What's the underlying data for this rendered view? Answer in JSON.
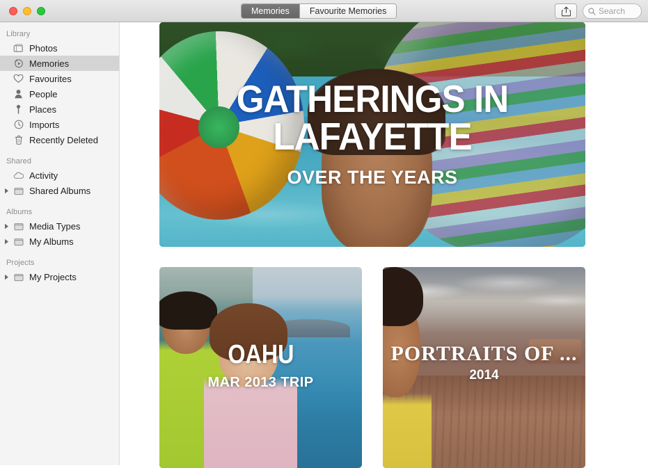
{
  "window": {
    "traffic_lights": [
      "close",
      "minimize",
      "zoom"
    ]
  },
  "toolbar": {
    "segments": [
      {
        "label": "Memories",
        "selected": true
      },
      {
        "label": "Favourite Memories",
        "selected": false
      }
    ],
    "share_button_label": "Share",
    "search": {
      "placeholder": "Search",
      "value": ""
    }
  },
  "sidebar": {
    "sections": [
      {
        "header": "Library",
        "items": [
          {
            "label": "Photos",
            "icon": "photos-icon",
            "selected": false,
            "twisty": false
          },
          {
            "label": "Memories",
            "icon": "memories-icon",
            "selected": true,
            "twisty": false
          },
          {
            "label": "Favourites",
            "icon": "heart-icon",
            "selected": false,
            "twisty": false
          },
          {
            "label": "People",
            "icon": "person-icon",
            "selected": false,
            "twisty": false
          },
          {
            "label": "Places",
            "icon": "pin-icon",
            "selected": false,
            "twisty": false
          },
          {
            "label": "Imports",
            "icon": "clock-icon",
            "selected": false,
            "twisty": false
          },
          {
            "label": "Recently Deleted",
            "icon": "trash-icon",
            "selected": false,
            "twisty": false
          }
        ]
      },
      {
        "header": "Shared",
        "items": [
          {
            "label": "Activity",
            "icon": "cloud-icon",
            "selected": false,
            "twisty": false
          },
          {
            "label": "Shared Albums",
            "icon": "album-icon",
            "selected": false,
            "twisty": true
          }
        ]
      },
      {
        "header": "Albums",
        "items": [
          {
            "label": "Media Types",
            "icon": "album-icon",
            "selected": false,
            "twisty": true
          },
          {
            "label": "My Albums",
            "icon": "album-icon",
            "selected": false,
            "twisty": true
          }
        ]
      },
      {
        "header": "Projects",
        "items": [
          {
            "label": "My Projects",
            "icon": "album-icon",
            "selected": false,
            "twisty": true
          }
        ]
      }
    ]
  },
  "memories": [
    {
      "title": "GATHERINGS IN LAFAYETTE",
      "subtitle": "OVER THE YEARS",
      "photo": "beach-ball-pool"
    },
    {
      "title": "OAHU",
      "subtitle": "MAR 2013 TRIP",
      "photo": "couple-ocean-overlook"
    },
    {
      "title": "PORTRAITS OF ...",
      "subtitle": "2014",
      "photo": "canyon-portrait"
    }
  ],
  "colors": {
    "sidebar_background": "#f4f4f4",
    "sidebar_selection": "#d4d4d4",
    "titlebar_top": "#e9e9e9",
    "titlebar_bottom": "#d8d8d8",
    "segment_active": "#6b6b6b",
    "content_background": "#ffffff"
  }
}
